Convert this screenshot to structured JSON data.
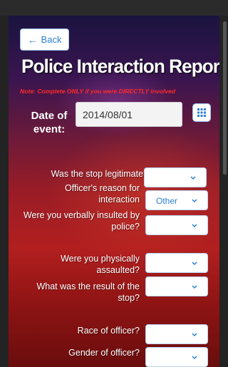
{
  "nav": {
    "back_label": "Back"
  },
  "header": {
    "title": "Police Interaction Report",
    "note": "Note: Complete ONLY if you were DIRECTLY involved"
  },
  "date_field": {
    "label": "Date of event:",
    "value": "2014/08/01"
  },
  "questions": [
    {
      "label": "Was the stop legitimate?",
      "value": ""
    },
    {
      "label": "Officer's reason for interaction",
      "value": "Other"
    },
    {
      "label": "Were you verbally insulted by police?",
      "value": ""
    },
    {
      "label": "Were you physically assaulted?",
      "value": ""
    },
    {
      "label": "What was the result of the stop?",
      "value": ""
    },
    {
      "label": "Race of officer?",
      "value": ""
    },
    {
      "label": "Gender of officer?",
      "value": ""
    }
  ],
  "colors": {
    "accent": "#2a7fd6",
    "note": "#ff2a2a"
  },
  "icons": {
    "back": "left-arrow-icon",
    "calendar": "calendar-grid-icon",
    "dropdown": "chevron-down-icon"
  }
}
